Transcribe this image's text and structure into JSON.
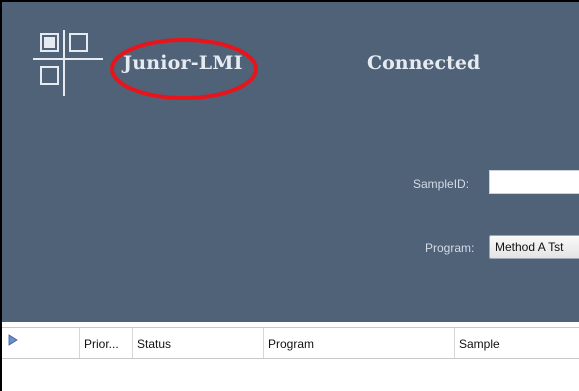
{
  "app": {
    "name": "Junior-LMI"
  },
  "connection": {
    "status": "Connected"
  },
  "form": {
    "sample_id_label": "SampleID:",
    "sample_id_value": "",
    "program_label": "Program:",
    "program_value": "Method A Tst"
  },
  "grid": {
    "columns": [
      "",
      "Prior...",
      "Status",
      "Program",
      "Sample"
    ]
  },
  "colors": {
    "header_bg": "#4f6278",
    "highlight_ring": "#e8141c"
  },
  "icons": {
    "logo": "lmi-logo-icon",
    "expand": "triangle-right-icon"
  }
}
